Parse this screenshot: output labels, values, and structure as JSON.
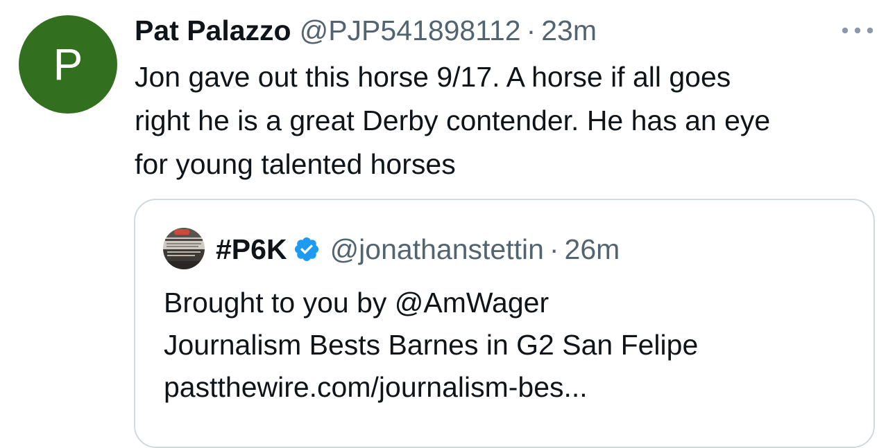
{
  "tweet": {
    "avatar_letter": "P",
    "avatar_color": "#32701f",
    "display_name": "Pat Palazzo",
    "handle": "@PJP541898112",
    "separator": "·",
    "time": "23m",
    "more_icon": "more-horizontal-icon",
    "text_lines": [
      "Jon gave out this horse 9/17. A horse if all goes",
      "right he is a great Derby contender. He has an eye",
      "for young talented horses"
    ]
  },
  "quote": {
    "display_name": "#P6K",
    "verified_icon": "verified-badge-icon",
    "verified_color": "#1d9bf0",
    "handle": "@jonathanstettin",
    "separator": "·",
    "time": "26m",
    "text_lines": [
      "Brought to you by @AmWager",
      "Journalism Bests Barnes in G2 San Felipe",
      "pastthewire.com/journalism-bes..."
    ]
  },
  "colors": {
    "text_primary": "#0f1419",
    "text_secondary": "#536471",
    "border": "#cfd9de"
  }
}
